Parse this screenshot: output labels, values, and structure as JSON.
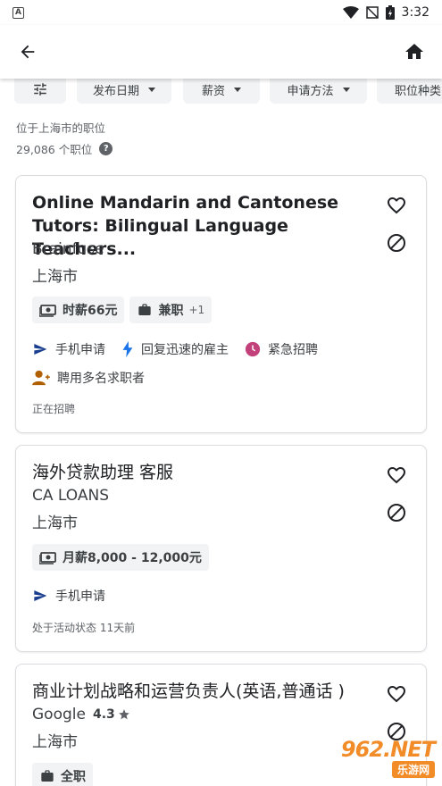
{
  "status_bar": {
    "left_icon_letter": "A",
    "time": "3:32",
    "icons": [
      "wifi-icon",
      "signal-off-icon",
      "battery-charging-icon"
    ]
  },
  "app_bar": {
    "back_icon": "arrow-left-icon",
    "home_icon": "home-icon"
  },
  "filters": {
    "settings_icon": "tune-icon",
    "chips": [
      {
        "label": "发布日期"
      },
      {
        "label": "薪资"
      },
      {
        "label": "申请方法"
      },
      {
        "label": "职位种类"
      }
    ]
  },
  "results": {
    "location_text": "位于上海市的职位",
    "count_text": "29,086 个职位",
    "help_symbol": "?"
  },
  "jobs": [
    {
      "title": "Online Mandarin and Cantonese Tutors: Bilingual Language Teachers...",
      "company": "Brainfuse",
      "city": "上海市",
      "tags": [
        {
          "icon": "money-icon",
          "label": "时薪66元",
          "extra": ""
        },
        {
          "icon": "briefcase-icon",
          "label": "兼职",
          "extra": "+1"
        }
      ],
      "features": [
        {
          "icon": "send-icon",
          "label": "手机申请",
          "color": "#1a3e8f"
        },
        {
          "icon": "bolt-icon",
          "label": "回复迅速的雇主",
          "color": "#1a73e8"
        },
        {
          "icon": "clock-icon",
          "label": "紧急招聘",
          "color": "#c2417a"
        }
      ],
      "features_row2": [
        {
          "icon": "person-add-icon",
          "label": "聘用多名求职者",
          "color": "#b06000"
        }
      ],
      "status": "正在招聘"
    },
    {
      "title": "海外贷款助理 客服",
      "company": "CA LOANS",
      "city": "上海市",
      "tags": [
        {
          "icon": "money-icon",
          "label": "月薪8,000 - 12,000元",
          "extra": ""
        }
      ],
      "features": [
        {
          "icon": "send-icon",
          "label": "手机申请",
          "color": "#1a3e8f"
        }
      ],
      "status": "处于活动状态 11天前"
    },
    {
      "title": "商业计划战略和运营负责人(英语,普通话 )",
      "company": "Google",
      "rating": "4.3",
      "city": "上海市",
      "tags": [
        {
          "icon": "briefcase-icon",
          "label": "全职",
          "extra": ""
        }
      ]
    }
  ],
  "watermark": {
    "top": "962.NET",
    "bottom": "乐游网"
  }
}
